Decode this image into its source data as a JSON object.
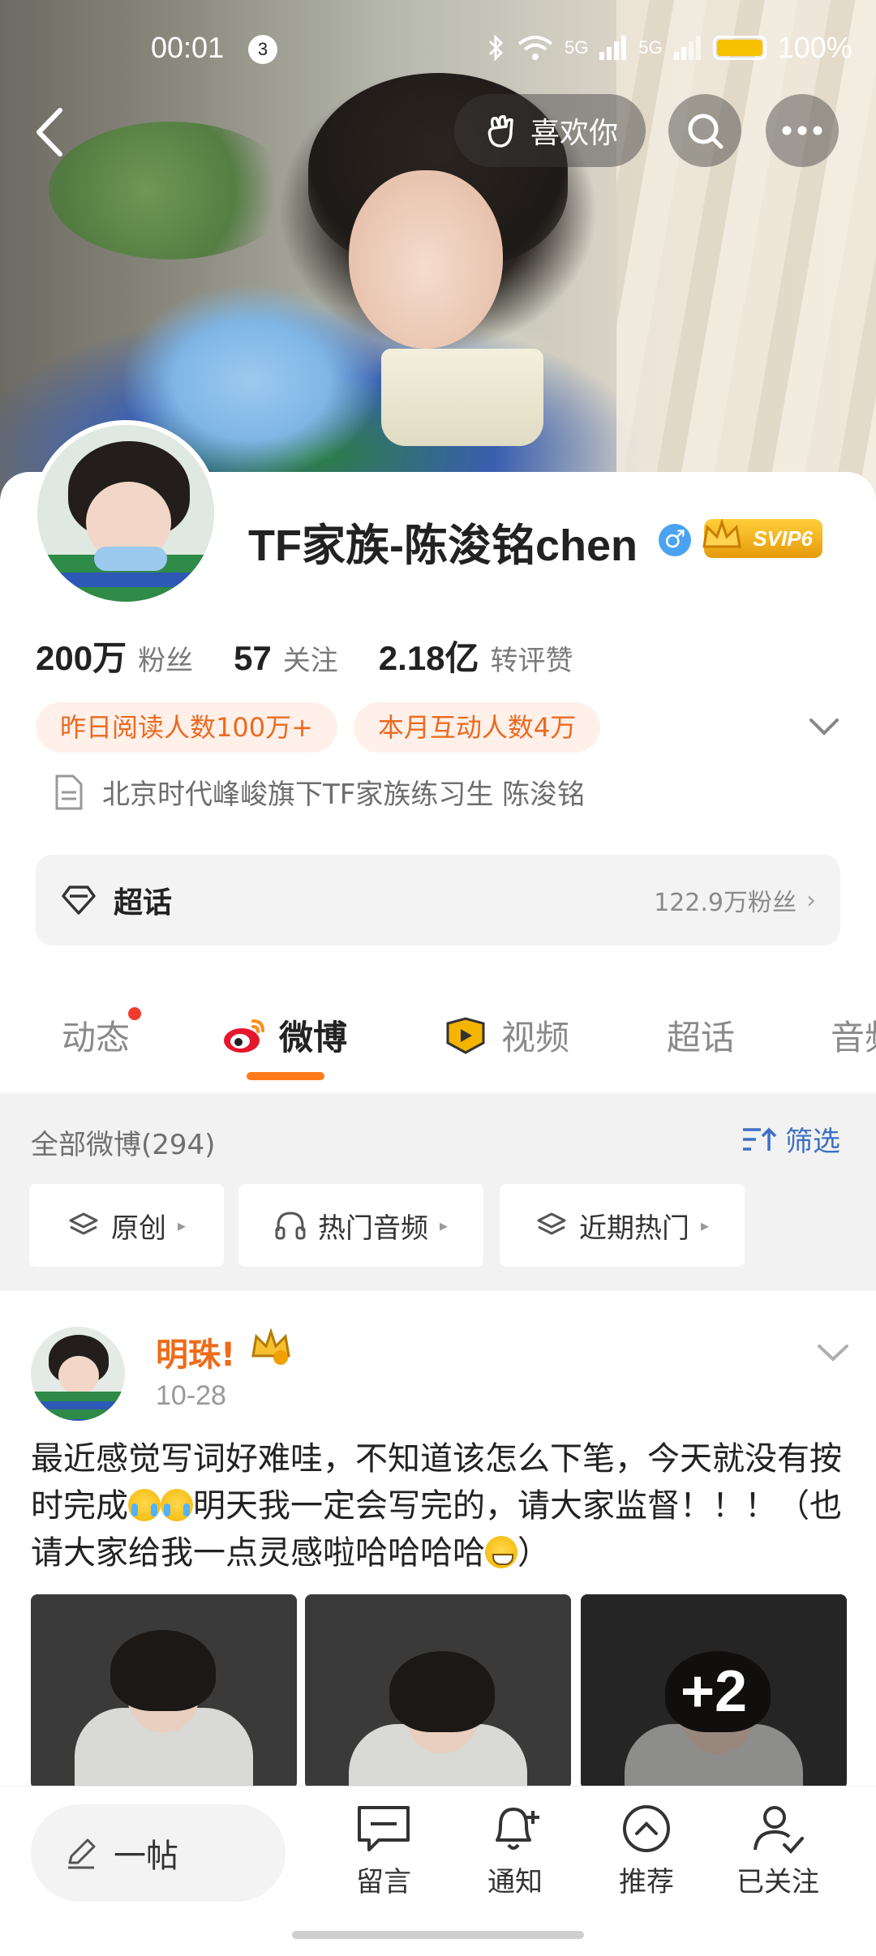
{
  "status_bar": {
    "time": "00:01",
    "notification_count": "3",
    "signal_1": "5G",
    "signal_2": "5G",
    "battery_pct": "100%",
    "battery_color": "#f6c100"
  },
  "top_nav": {
    "back_icon": "chevron-left-icon",
    "like_label": "喜欢你",
    "search_icon": "search-icon",
    "more_icon": "more-dots-icon"
  },
  "profile": {
    "username": "TF家族-陈浚铭chen",
    "gender_symbol": "♂",
    "vip_label": "SVIP6",
    "stats": [
      {
        "value": "200万",
        "label": "粉丝"
      },
      {
        "value": "57",
        "label": "关注"
      },
      {
        "value": "2.18亿",
        "label": "转评赞"
      }
    ],
    "tags": [
      "昨日阅读人数100万+",
      "本月互动人数4万"
    ],
    "bio": "北京时代峰峻旗下TF家族练习生  陈浚铭",
    "super_topic": {
      "label": "超话",
      "fans": "122.9万粉丝",
      "arrow": "›"
    }
  },
  "tabs": [
    {
      "label": "动态"
    },
    {
      "label": "微博"
    },
    {
      "label": "视频"
    },
    {
      "label": "超话"
    },
    {
      "label": "音频"
    }
  ],
  "filter": {
    "title": "全部微博(294)",
    "filter_label": "筛选",
    "chips": [
      "原创",
      "热门音频",
      "近期热门"
    ],
    "chip_arrow": "▸"
  },
  "post": {
    "author": "明珠!",
    "date": "10-28",
    "text_part1": "最近感觉写词好难哇，不知道该怎么下笔，今天就没有按时完成",
    "text_part2": "明天我一定会写完的，请大家监督！！！（也请大家给我一点灵感啦哈哈哈哈",
    "text_part3": "）",
    "more_photos": "+2"
  },
  "bottom_bar": {
    "compose_label": "一帖",
    "items": [
      {
        "label": "留言",
        "icon": "message-icon"
      },
      {
        "label": "通知",
        "icon": "bell-plus-icon"
      },
      {
        "label": "推荐",
        "icon": "chevron-up-circle-icon"
      },
      {
        "label": "已关注",
        "icon": "user-check-icon"
      }
    ]
  },
  "colors": {
    "accent_orange": "#ff7a1a",
    "link_blue": "#3d6fc4",
    "tag_text": "#ec6a1f"
  }
}
